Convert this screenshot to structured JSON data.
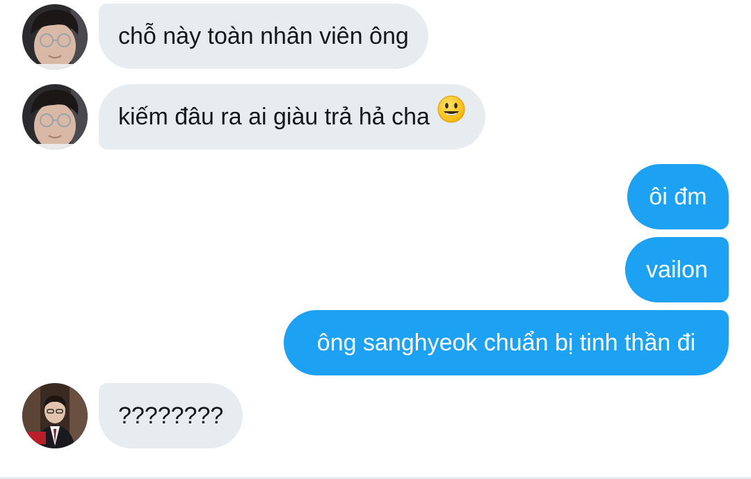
{
  "messages": [
    {
      "direction": "incoming",
      "sender": "contact-1",
      "text": "chỗ này toàn nhân viên ông"
    },
    {
      "direction": "incoming",
      "sender": "contact-1",
      "text": "kiếm đâu ra ai giàu trả hả cha",
      "emoji": "smiley-face"
    },
    {
      "direction": "outgoing",
      "text": "ôi đm"
    },
    {
      "direction": "outgoing",
      "text": "vailon"
    },
    {
      "direction": "outgoing",
      "text": "ông sanghyeok chuẩn bị tinh thần đi"
    },
    {
      "direction": "incoming",
      "sender": "contact-2",
      "text": "????????"
    }
  ],
  "colors": {
    "incoming_bubble": "#e7ecf0",
    "incoming_text": "#14171a",
    "outgoing_bubble": "#1da1f2",
    "outgoing_text": "#ffffff"
  }
}
